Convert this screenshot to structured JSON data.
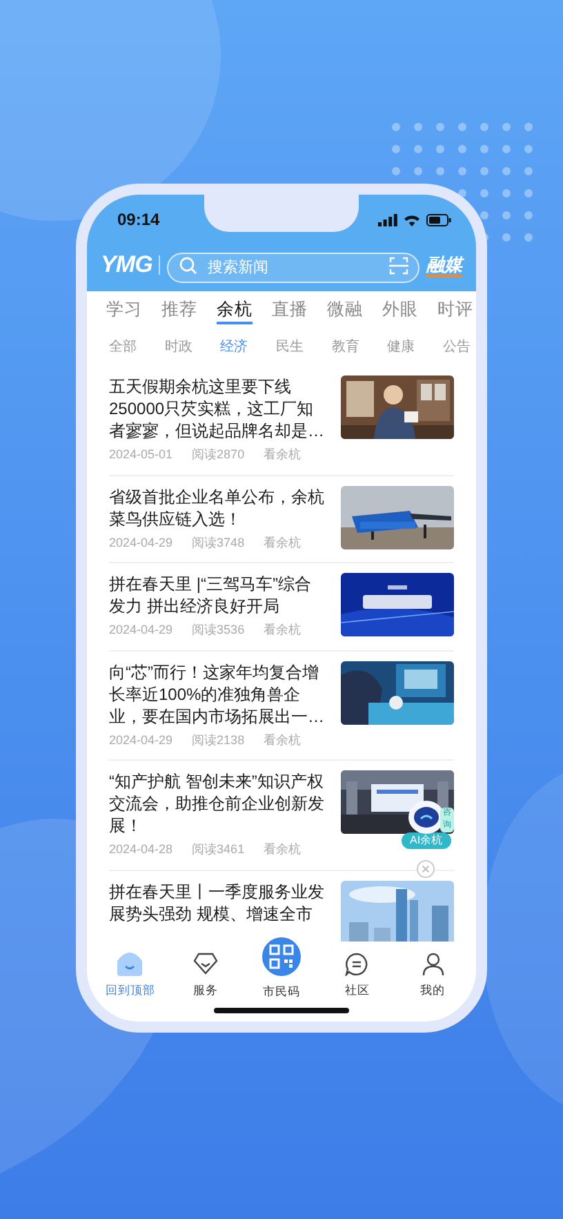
{
  "status_bar": {
    "time": "09:14"
  },
  "header": {
    "logo": "YMG",
    "search": {
      "placeholder": "搜索新闻"
    },
    "brand": "融媒"
  },
  "tabs": [
    {
      "label": "学习",
      "selected": false
    },
    {
      "label": "推荐",
      "selected": false
    },
    {
      "label": "余杭",
      "selected": true
    },
    {
      "label": "直播",
      "selected": false
    },
    {
      "label": "微融",
      "selected": false
    },
    {
      "label": "外眼",
      "selected": false
    },
    {
      "label": "时评",
      "selected": false
    }
  ],
  "subtabs": [
    {
      "label": "全部",
      "selected": false
    },
    {
      "label": "时政",
      "selected": false
    },
    {
      "label": "经济",
      "selected": true
    },
    {
      "label": "民生",
      "selected": false
    },
    {
      "label": "教育",
      "selected": false
    },
    {
      "label": "健康",
      "selected": false
    },
    {
      "label": "公告",
      "selected": false
    }
  ],
  "articles": [
    {
      "title": "五天假期余杭这里要下线250000只芡实糕，这工厂知者寥寥，但说起品牌名却是…",
      "date": "2024-05-01",
      "reads": "阅读2870",
      "source": "看余杭"
    },
    {
      "title": "省级首批企业名单公布，余杭菜鸟供应链入选！",
      "date": "2024-04-29",
      "reads": "阅读3748",
      "source": "看余杭"
    },
    {
      "title": "拼在春天里 |“三驾马车”综合发力 拼出经济良好开局",
      "date": "2024-04-29",
      "reads": "阅读3536",
      "source": "看余杭"
    },
    {
      "title": "向“芯”而行！这家年均复合增长率近100%的准独角兽企业，要在国内市场拓展出一…",
      "date": "2024-04-29",
      "reads": "阅读2138",
      "source": "看余杭"
    },
    {
      "title": "“知产护航 智创未来”知识产权交流会，助推仓前企业创新发展！",
      "date": "2024-04-28",
      "reads": "阅读3461",
      "source": "看余杭"
    },
    {
      "title": "拼在春天里丨一季度服务业发展势头强劲 规模、增速全市"
    }
  ],
  "assistant": {
    "bubble": "咨询",
    "label": "AI余杭"
  },
  "bottom_nav": [
    {
      "label": "回到顶部",
      "selected": true,
      "kind": "tab"
    },
    {
      "label": "服务",
      "selected": false,
      "kind": "tab"
    },
    {
      "label": "市民码",
      "selected": false,
      "kind": "center"
    },
    {
      "label": "社区",
      "selected": false,
      "kind": "tab"
    },
    {
      "label": "我的",
      "selected": false,
      "kind": "tab"
    }
  ]
}
